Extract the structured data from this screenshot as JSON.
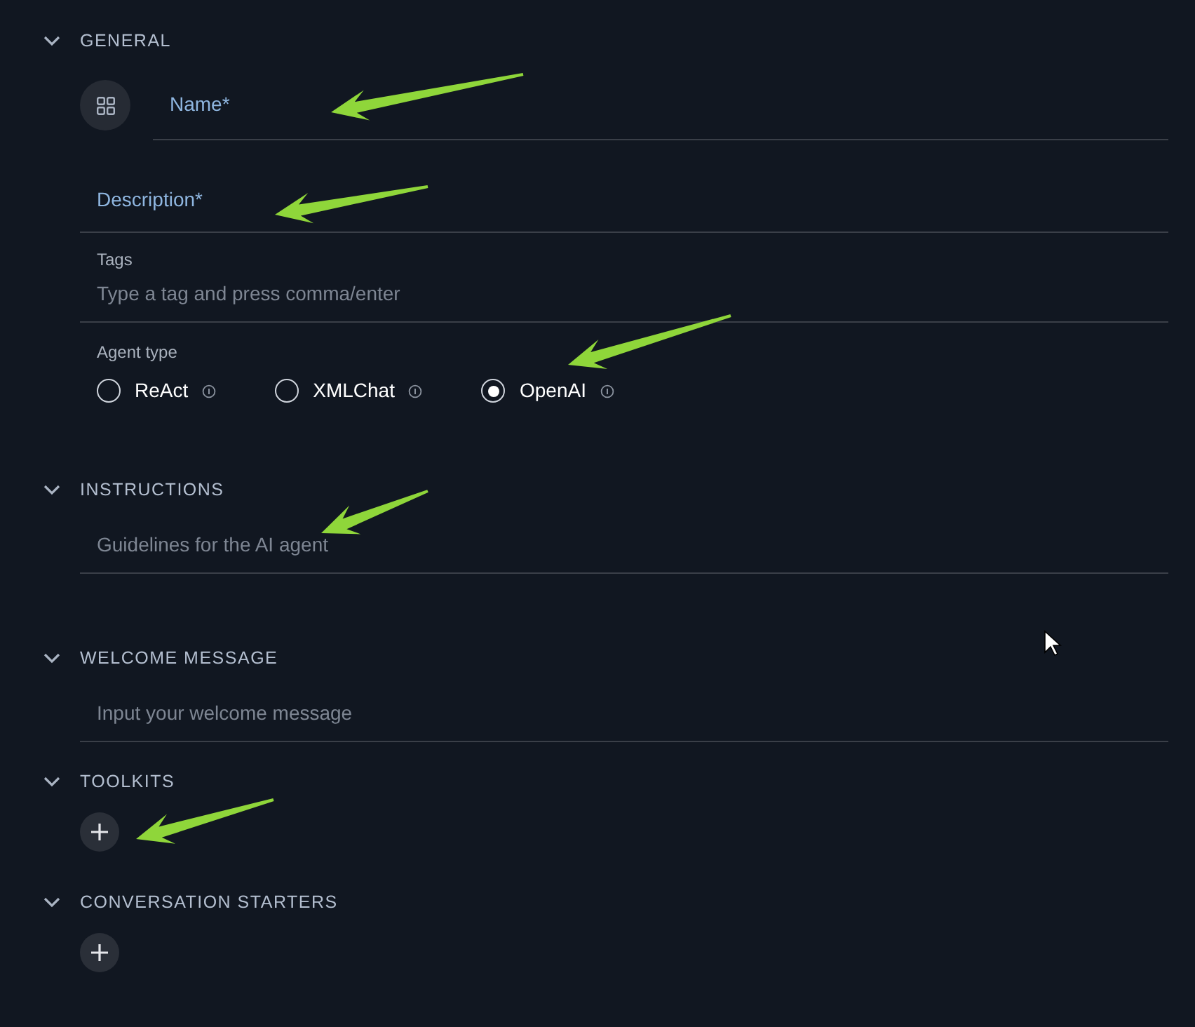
{
  "sections": [
    {
      "title": "GENERAL",
      "expanded": true,
      "kind": "general"
    },
    {
      "title": "INSTRUCTIONS",
      "expanded": true,
      "kind": "text",
      "placeholder": "Guidelines for the AI agent"
    },
    {
      "title": "WELCOME MESSAGE",
      "expanded": true,
      "kind": "text",
      "placeholder": "Input your welcome message"
    },
    {
      "title": "TOOLKITS",
      "expanded": true,
      "kind": "add"
    },
    {
      "title": "CONVERSATION STARTERS",
      "expanded": true,
      "kind": "add"
    }
  ],
  "general": {
    "name_label": "Name*",
    "description_label": "Description*",
    "tags_label": "Tags",
    "tags_placeholder": "Type a tag and press comma/enter",
    "agent_type_label": "Agent type",
    "agent_types": [
      {
        "label": "ReAct",
        "selected": false
      },
      {
        "label": "XMLChat",
        "selected": false
      },
      {
        "label": "OpenAI",
        "selected": true
      }
    ]
  }
}
